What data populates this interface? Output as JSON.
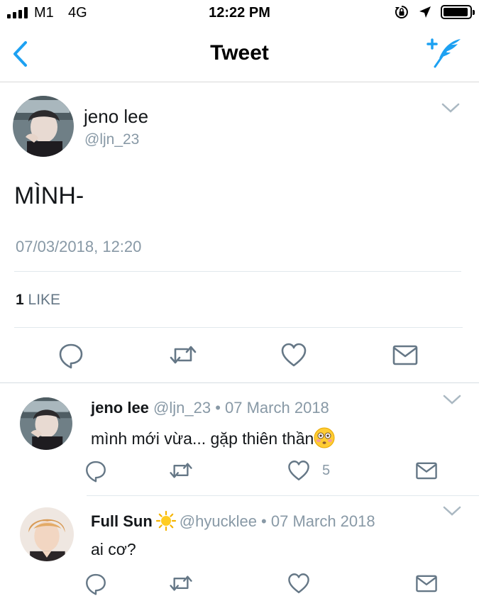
{
  "status_bar": {
    "carrier": "M1",
    "network": "4G",
    "time": "12:22 PM",
    "battery_level": 0.95
  },
  "nav": {
    "title": "Tweet",
    "accent_color": "#1da1f2"
  },
  "tweet": {
    "author_name": "jeno lee",
    "author_handle": "@ljn_23",
    "text": "MÌNH-",
    "timestamp": "07/03/2018, 12:20",
    "like_count": "1",
    "like_label": "LIKE",
    "actions": [
      "reply-icon",
      "retweet-icon",
      "like-icon",
      "message-icon"
    ]
  },
  "replies": [
    {
      "name": "jeno lee",
      "meta": "@ljn_23 • 07 March 2018",
      "text": "mình mới vừa... gặp thiên thần",
      "emoji": "flushed-face-emoji",
      "like_count": "5"
    },
    {
      "name": "Full Sun",
      "name_emoji": "sun-emoji",
      "meta": "@hyucklee • 07 March 2018",
      "text": "ai cơ?",
      "like_count": ""
    }
  ]
}
